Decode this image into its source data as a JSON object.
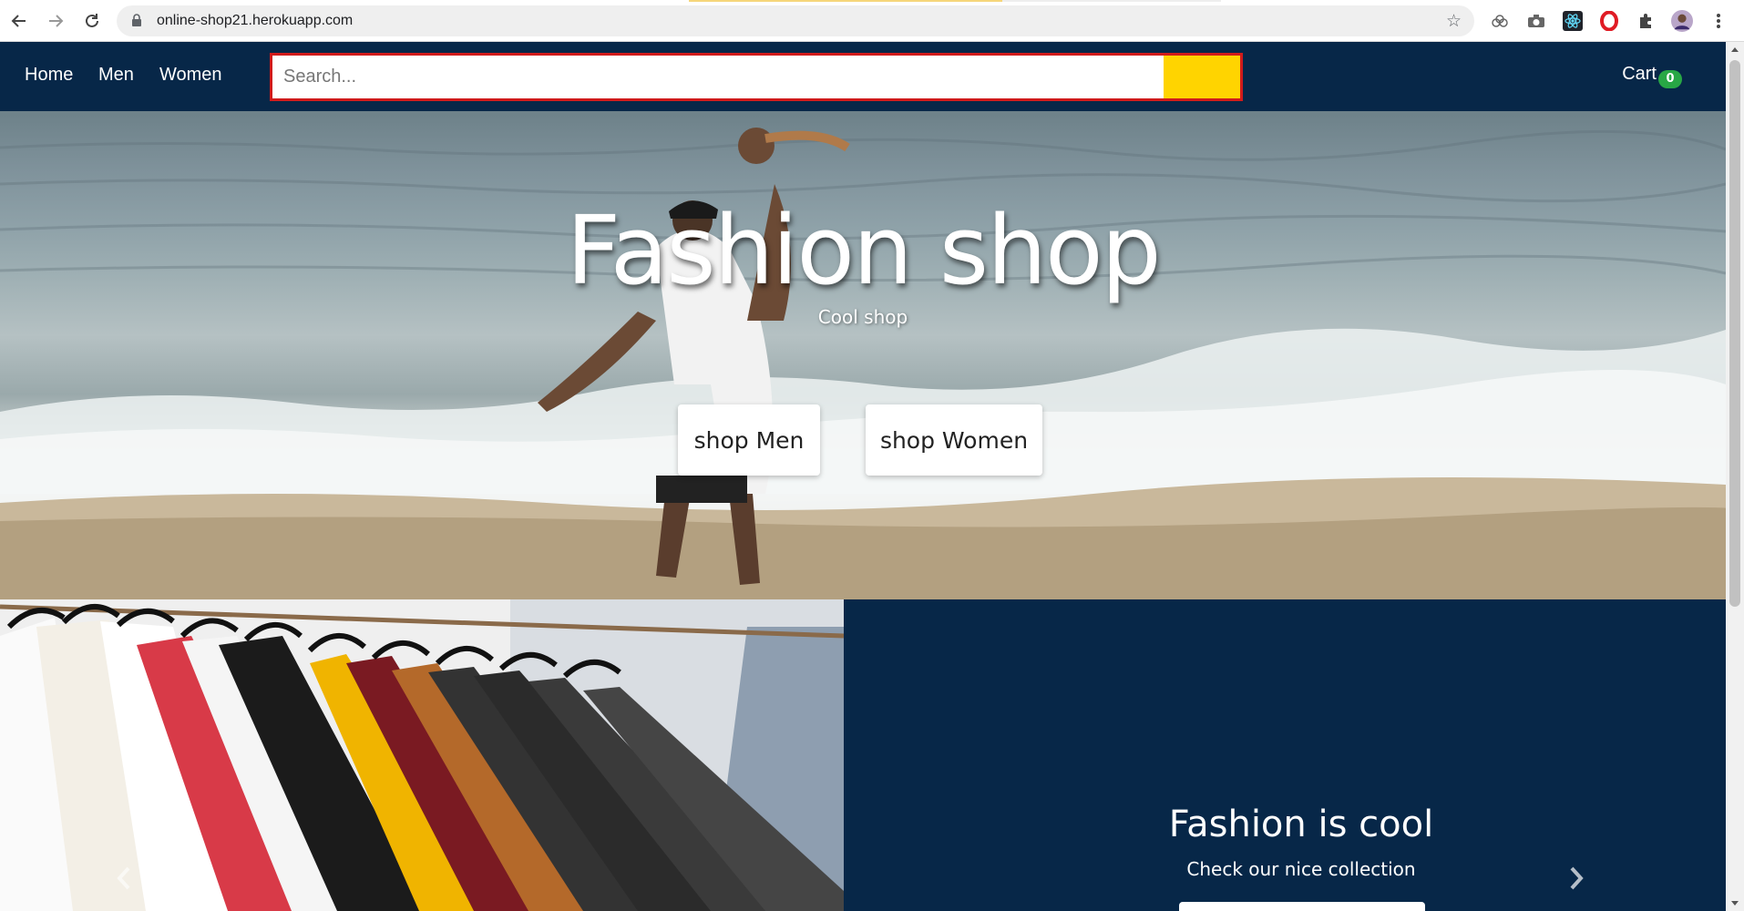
{
  "browser": {
    "url": "online-shop21.herokuapp.com",
    "icons": [
      "back-arrow-icon",
      "forward-arrow-icon",
      "reload-icon",
      "lock-icon",
      "star-icon",
      "extension-icons",
      "profile-avatar",
      "menu-dots-icon"
    ]
  },
  "nav": {
    "links": [
      "Home",
      "Men",
      "Women"
    ],
    "search_placeholder": "Search...",
    "cart_label": "Cart",
    "cart_count": "0"
  },
  "hero": {
    "title": "Fashion shop",
    "subtitle": "Cool shop",
    "buttons": [
      "shop Men",
      "shop Women"
    ]
  },
  "carousel": {
    "title": "Fashion is cool",
    "subtitle": "Check our nice collection"
  },
  "colors": {
    "nav_bg": "#072748",
    "search_border": "#d11b1b",
    "search_button": "#ffd400",
    "cart_badge": "#28a745"
  }
}
